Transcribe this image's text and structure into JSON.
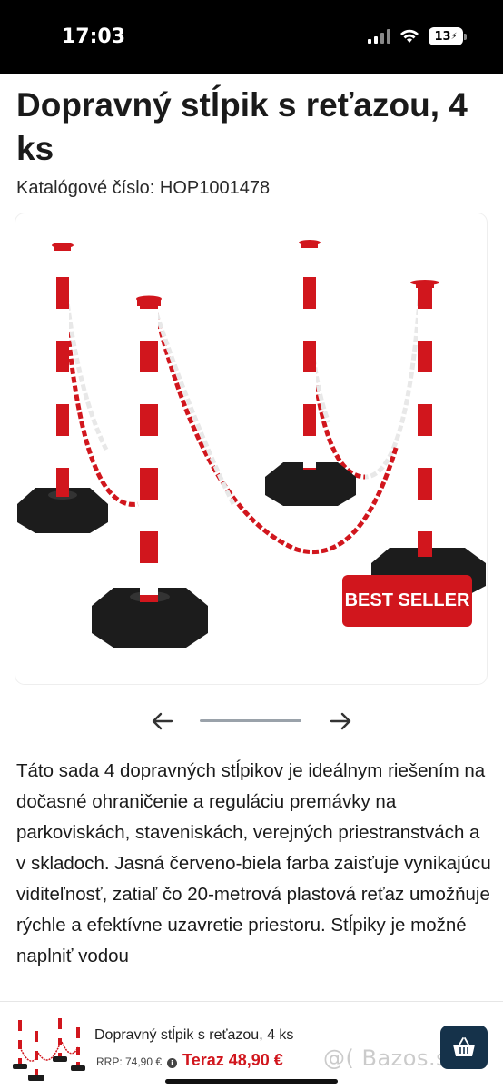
{
  "status_bar": {
    "time": "17:03",
    "battery": "13",
    "icons": [
      "signal-icon",
      "wifi-icon",
      "battery-charging-icon"
    ]
  },
  "product": {
    "title": "Dopravný stĺpik s reťazou, 4 ks",
    "catalog_label": "Katalógové číslo: HOP1001478",
    "badge": "BEST SELLER",
    "image_subject": "four red-white traffic posts with chain on black octagonal bases",
    "description": "Táto sada 4 dopravných stĺpikov je ideálnym riešením na dočasné ohraničenie a reguláciu premávky na parkoviskách, staveniskách, verejných priestranstvách a v skladoch. Jasná červeno-biela farba zaisťuje vynikajúcu viditeľnosť, zatiaľ čo 20-metrová plastová reťaz umožňuje rýchle a efektívne uzavretie priestoru. Stĺpiky je možné naplniť vodou"
  },
  "carousel": {
    "icons": [
      "arrow-left-icon",
      "arrow-right-icon"
    ]
  },
  "bottom_bar": {
    "name": "Dopravný stĺpik s reťazou, 4 ks",
    "rrp": "RRP: 74,90 €",
    "now": "Teraz 48,90 €",
    "cart_icon": "basket-icon",
    "watermark": "@( Bazos.sk"
  },
  "colors": {
    "accent_red": "#d1161d",
    "cart_button": "#15324a",
    "post_white": "#ffffff",
    "base_black": "#1c1c1c"
  }
}
